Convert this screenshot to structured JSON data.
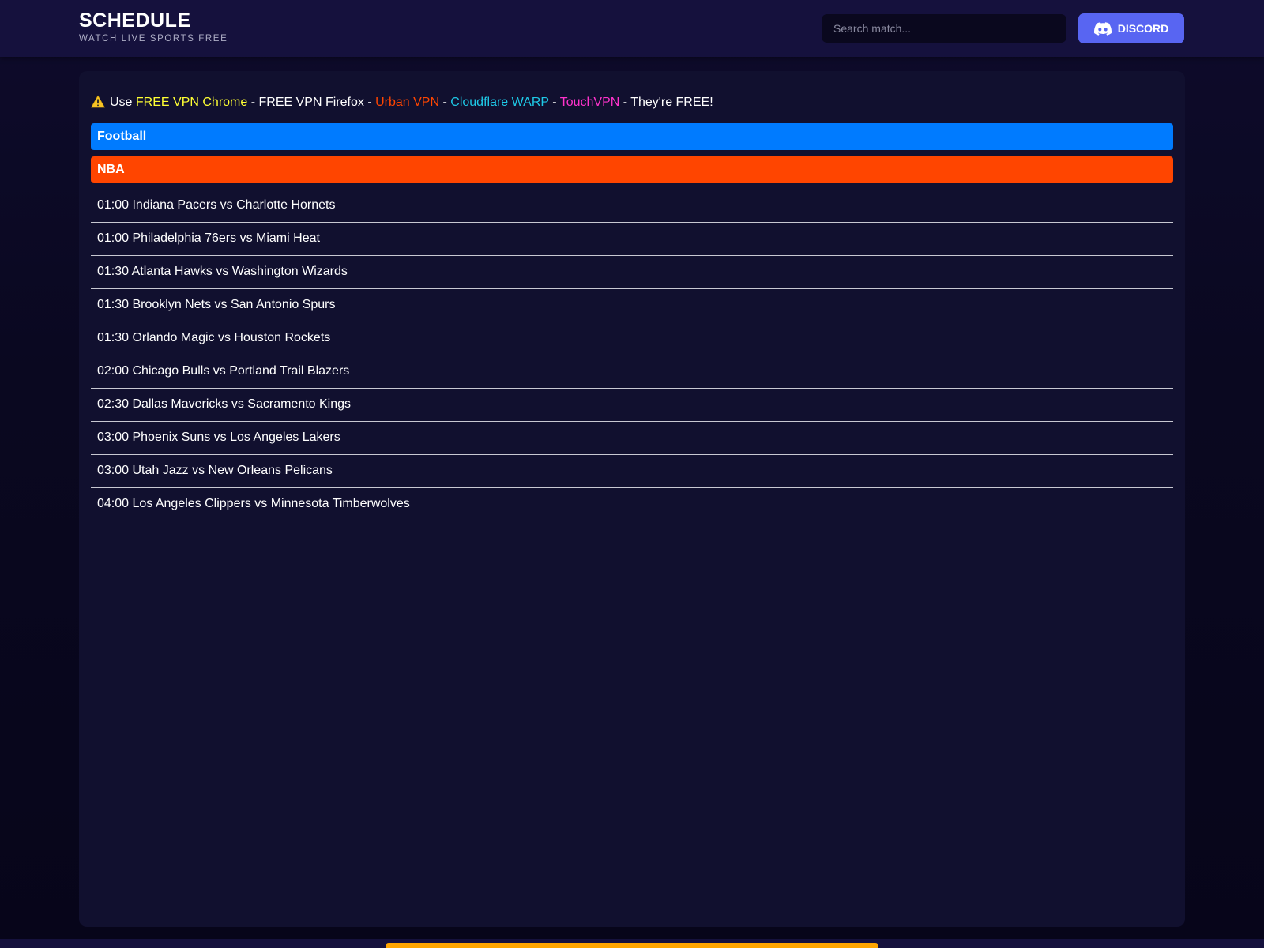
{
  "header": {
    "title": "SCHEDULE",
    "subtitle": "WATCH LIVE SPORTS FREE",
    "search_placeholder": "Search match...",
    "discord_label": "DISCORD"
  },
  "notice": {
    "prefix": "Use",
    "links": [
      {
        "label": "FREE VPN Chrome",
        "color": "#ffff33"
      },
      {
        "label": "FREE VPN Firefox",
        "color": "#ffffff"
      },
      {
        "label": "Urban VPN",
        "color": "#ff4500"
      },
      {
        "label": "Cloudflare WARP",
        "color": "#1ec8e6"
      },
      {
        "label": "TouchVPN",
        "color": "#ff33cc"
      }
    ],
    "separator": "-",
    "suffix": "- They're FREE!"
  },
  "categories": [
    {
      "label": "Football",
      "color": "#007bff"
    },
    {
      "label": "NBA",
      "color": "#ff4500"
    }
  ],
  "matches": [
    "01:00 Indiana Pacers vs Charlotte Hornets",
    "01:00 Philadelphia 76ers vs Miami Heat",
    "01:30 Atlanta Hawks vs Washington Wizards",
    "01:30 Brooklyn Nets vs San Antonio Spurs",
    "01:30 Orlando Magic vs Houston Rockets",
    "02:00 Chicago Bulls vs Portland Trail Blazers",
    "02:30 Dallas Mavericks vs Sacramento Kings",
    "03:00 Phoenix Suns vs Los Angeles Lakers",
    "03:00 Utah Jazz vs New Orleans Pelicans",
    "04:00 Los Angeles Clippers vs Minnesota Timberwolves"
  ],
  "colors": {
    "discord": "#5865f2",
    "footer_accent": "#ffa500"
  },
  "icons": {
    "warning": "warning-icon",
    "discord": "discord-icon"
  }
}
